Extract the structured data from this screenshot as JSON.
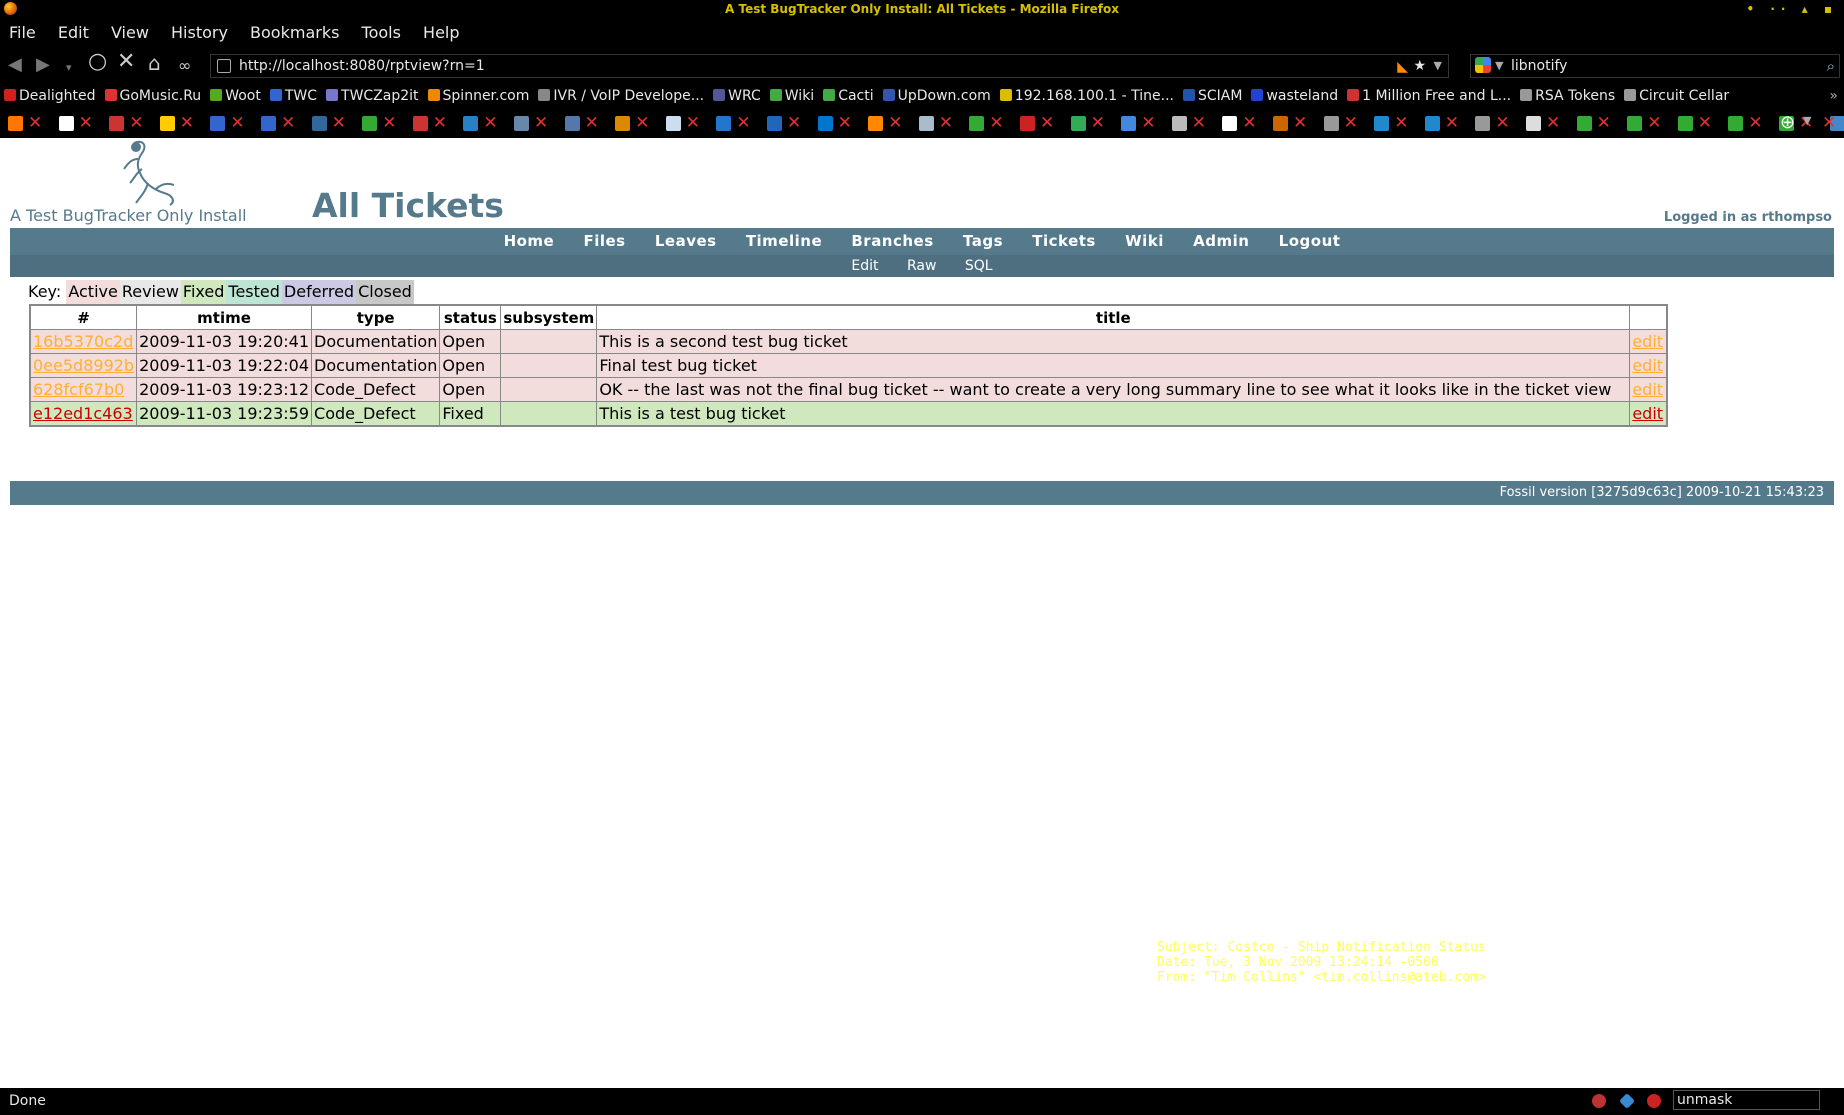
{
  "window": {
    "title": "A Test BugTracker Only Install: All Tickets - Mozilla Firefox",
    "controls": "• ·· ▴ ▪"
  },
  "menu": [
    "File",
    "Edit",
    "View",
    "History",
    "Bookmarks",
    "Tools",
    "Help"
  ],
  "nav": {
    "url": "http://localhost:8080/rptview?rn=1",
    "search_query": "libnotify"
  },
  "bookmarks": [
    {
      "label": "Dealighted",
      "color": "#cc2222"
    },
    {
      "label": "GoMusic.Ru",
      "color": "#dd3333"
    },
    {
      "label": "Woot",
      "color": "#55aa22"
    },
    {
      "label": "TWC",
      "color": "#3366cc"
    },
    {
      "label": "TWCZap2it",
      "color": "#7777cc"
    },
    {
      "label": "Spinner.com",
      "color": "#ee8800"
    },
    {
      "label": "IVR / VoIP Develope...",
      "color": "#888888"
    },
    {
      "label": "WRC",
      "color": "#555599"
    },
    {
      "label": "Wiki",
      "color": "#44aa44"
    },
    {
      "label": "Cacti",
      "color": "#44aa44"
    },
    {
      "label": "UpDown.com",
      "color": "#3355aa"
    },
    {
      "label": "192.168.100.1 - Tine...",
      "color": "#ddbb00"
    },
    {
      "label": "SCIAM",
      "color": "#2255aa"
    },
    {
      "label": "wasteland",
      "color": "#2244cc"
    },
    {
      "label": "1 Million Free and L...",
      "color": "#cc3333"
    },
    {
      "label": "RSA Tokens",
      "color": "#999999"
    },
    {
      "label": "Circuit Cellar",
      "color": "#999999"
    }
  ],
  "site": {
    "name": "A Test BugTracker Only Install",
    "page_title": "All Tickets",
    "login_status": "Logged in as rthompso"
  },
  "mainmenu": [
    "Home",
    "Files",
    "Leaves",
    "Timeline",
    "Branches",
    "Tags",
    "Tickets",
    "Wiki",
    "Admin",
    "Logout"
  ],
  "submenu": [
    "Edit",
    "Raw",
    "SQL"
  ],
  "key": {
    "label": "Key:",
    "items": [
      {
        "label": "Active",
        "color": "#f2dcdc"
      },
      {
        "label": "Review",
        "color": "#e8e8e8"
      },
      {
        "label": "Fixed",
        "color": "#cfe8bd"
      },
      {
        "label": "Tested",
        "color": "#bde5d6"
      },
      {
        "label": "Deferred",
        "color": "#cacae5"
      },
      {
        "label": "Closed",
        "color": "#c8c8c8"
      }
    ]
  },
  "table": {
    "columns": [
      "#",
      "mtime",
      "type",
      "status",
      "subsystem",
      "title",
      ""
    ],
    "rows": [
      {
        "id": "16b5370c2d",
        "mtime": "2009-11-03 19:20:41",
        "type": "Documentation",
        "status": "Open",
        "subsystem": "",
        "title": "This is a second test bug ticket",
        "edit": "edit",
        "bg": "#f2dcdc",
        "link": "#ffb030"
      },
      {
        "id": "0ee5d8992b",
        "mtime": "2009-11-03 19:22:04",
        "type": "Documentation",
        "status": "Open",
        "subsystem": "",
        "title": "Final test bug ticket",
        "edit": "edit",
        "bg": "#f2dcdc",
        "link": "#ffb030"
      },
      {
        "id": "628fcf67b0",
        "mtime": "2009-11-03 19:23:12",
        "type": "Code_Defect",
        "status": "Open",
        "subsystem": "",
        "title": "OK -- the last was not the final bug ticket -- want to create a very long summary line to see what it looks like in the ticket view",
        "edit": "edit",
        "bg": "#f2dcdc",
        "link": "#ffb030"
      },
      {
        "id": "e12ed1c463",
        "mtime": "2009-11-03 19:23:59",
        "type": "Code_Defect",
        "status": "Fixed",
        "subsystem": "",
        "title": "This is a test bug ticket",
        "edit": "edit",
        "bg": "#cfe8bd",
        "link": "#cc0000"
      }
    ]
  },
  "footer": "Fossil version [3275d9c63c] 2009-10-21 15:43:23",
  "overlay_mail": {
    "subject": "Subject: Costco - Ship Notification Status",
    "date": "Date: Tue, 3 Nov 2009 13:24:14 -0500",
    "from": "From: \"Tim Collins\" <tim.collins@ateb.com>"
  },
  "status": {
    "text": "Done",
    "unmask": "unmask"
  },
  "colors": {
    "accent": "#557a8c",
    "overlay": "#ffff55"
  }
}
